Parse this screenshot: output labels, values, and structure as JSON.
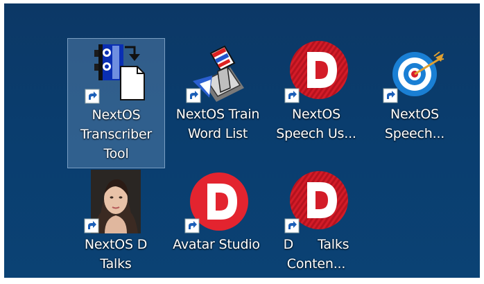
{
  "desktop": {
    "icons": [
      {
        "label": "NextOS\nTranscriber\nTool",
        "icon": "transcriber-tool-icon",
        "selected": true
      },
      {
        "label": "NextOS Train\nWord List",
        "icon": "train-word-list-icon",
        "selected": false
      },
      {
        "label": "NextOS\nSpeech Us...",
        "icon": "dragon-d-striped-icon",
        "selected": false
      },
      {
        "label": "NextOS\nSpeech...",
        "icon": "bullseye-target-icon",
        "selected": false
      },
      {
        "label": "NextOS D\nTalks",
        "icon": "avatar-portrait-icon",
        "selected": false
      },
      {
        "label": "Avatar Studio",
        "icon": "dragon-d-solid-icon",
        "selected": false
      },
      {
        "label": "D      Talks\nConten...",
        "icon": "dragon-d-striped-icon",
        "selected": false
      }
    ],
    "shortcut_icon": "shortcut-arrow-icon",
    "colors": {
      "background": "#0b3d6e",
      "selection": "#5f86ad",
      "dragon_red": "#d91e2a",
      "target_blue": "#1a7fd4"
    }
  }
}
